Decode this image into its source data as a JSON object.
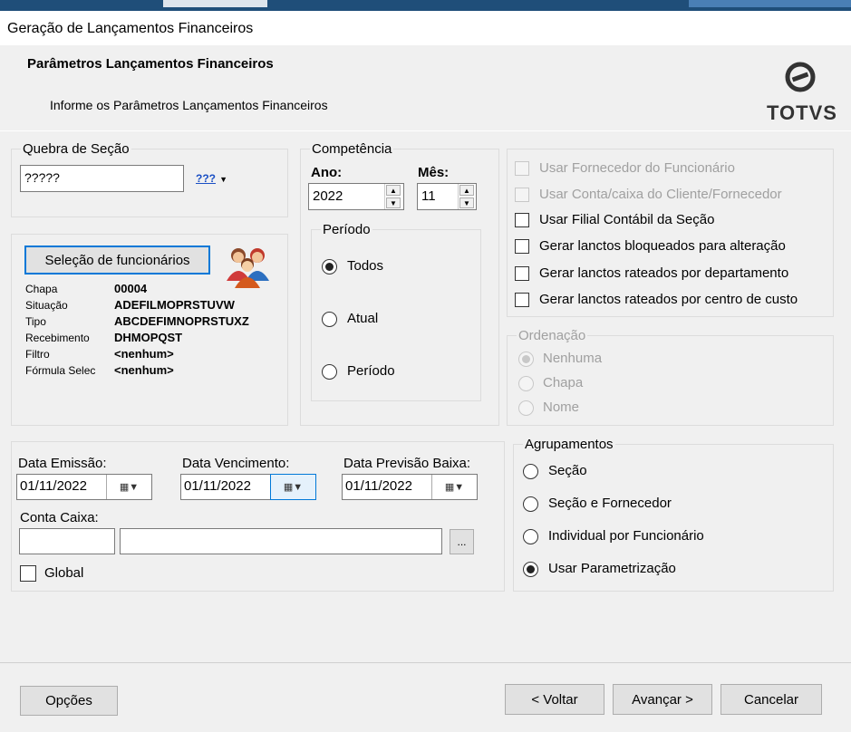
{
  "window": {
    "title": "Geração de Lançamentos Financeiros"
  },
  "header": {
    "title": "Parâmetros Lançamentos Financeiros",
    "subtitle": "Informe os Parâmetros Lançamentos Financeiros",
    "logo": "TOTVS"
  },
  "quebra": {
    "legend": "Quebra de Seção",
    "value": "?????",
    "selector_label": "???"
  },
  "selecao": {
    "button": "Seleção de funcionários",
    "rows": [
      {
        "label": "Chapa",
        "value": "00004"
      },
      {
        "label": "Situação",
        "value": "ADEFILMOPRSTUVW"
      },
      {
        "label": "Tipo",
        "value": "ABCDEFIMNOPRSTUXZ"
      },
      {
        "label": "Recebimento",
        "value": "DHMOPQST"
      },
      {
        "label": "Filtro",
        "value": "<nenhum>"
      },
      {
        "label": "Fórmula Selec",
        "value": "<nenhum>"
      }
    ]
  },
  "competencia": {
    "legend": "Competência",
    "ano_label": "Ano:",
    "ano_value": "2022",
    "mes_label": "Mês:",
    "mes_value": "11",
    "periodo_legend": "Período",
    "options": [
      "Todos",
      "Atual",
      "Período"
    ]
  },
  "checks": [
    {
      "label": "Usar Fornecedor do Funcionário",
      "enabled": false,
      "checked": false
    },
    {
      "label": "Usar Conta/caixa do Cliente/Fornecedor",
      "enabled": false,
      "checked": false
    },
    {
      "label": "Usar Filial Contábil da Seção",
      "enabled": true,
      "checked": false
    },
    {
      "label": "Gerar lanctos bloqueados para alteração",
      "enabled": true,
      "checked": false
    },
    {
      "label": "Gerar lanctos rateados por departamento",
      "enabled": true,
      "checked": false
    },
    {
      "label": "Gerar lanctos rateados por centro de custo",
      "enabled": true,
      "checked": false
    }
  ],
  "ordenacao": {
    "legend": "Ordenação",
    "options": [
      "Nenhuma",
      "Chapa",
      "Nome"
    ],
    "selected": "Nenhuma"
  },
  "datas": {
    "emissao_label": "Data Emissão:",
    "emissao_value": "01/11/2022",
    "vencimento_label": "Data Vencimento:",
    "vencimento_value": "01/11/2022",
    "previsao_label": "Data Previsão Baixa:",
    "previsao_value": "01/11/2022",
    "conta_label": "Conta Caixa:",
    "conta_code": "",
    "conta_desc": "",
    "browse": "...",
    "global_label": "Global"
  },
  "agrupamentos": {
    "legend": "Agrupamentos",
    "options": [
      "Seção",
      "Seção e Fornecedor",
      "Individual por Funcionário",
      "Usar Parametrização"
    ],
    "selected": "Usar Parametrização"
  },
  "footer": {
    "options": "Opções",
    "back": "< Voltar",
    "next": "Avançar >",
    "cancel": "Cancelar"
  }
}
